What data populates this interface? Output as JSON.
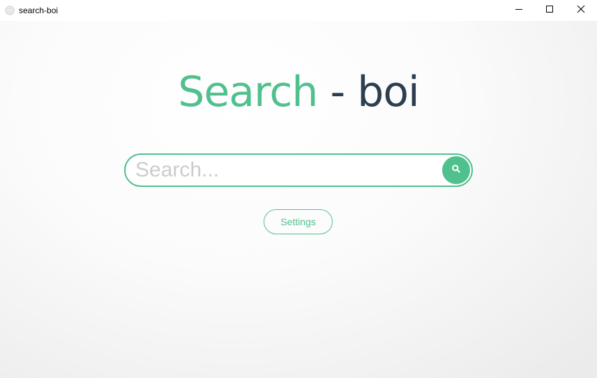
{
  "window": {
    "title": "search-boi",
    "app_icon": "app-globe-icon",
    "controls": {
      "minimize_icon": "minimize-icon",
      "maximize_icon": "maximize-icon",
      "close_icon": "close-icon"
    }
  },
  "main": {
    "heading_accent": "Search",
    "heading_rest": " - boi",
    "search": {
      "placeholder": "Search...",
      "value": "",
      "button_icon": "search-icon"
    },
    "settings_label": "Settings"
  },
  "colors": {
    "accent": "#50c08e",
    "heading_dark": "#2c3e50",
    "placeholder": "#cccccc"
  }
}
